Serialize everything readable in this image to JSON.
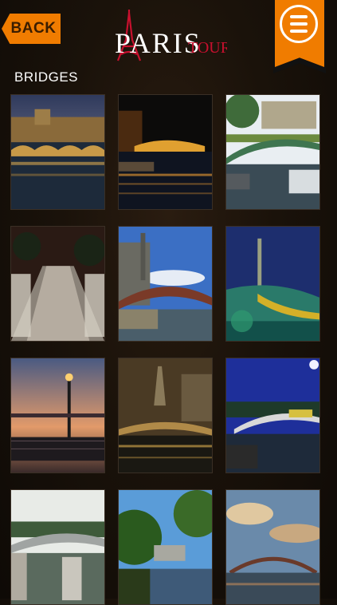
{
  "header": {
    "back_label": "BACK",
    "logo_text_main": "PARIS",
    "logo_text_sub": "TOURS"
  },
  "section": {
    "title": "BRIDGES"
  },
  "colors": {
    "accent": "#f07c00",
    "logo_red": "#c8102e"
  },
  "icons": {
    "menu": "hamburger-menu-icon",
    "back": "back-arrow-icon"
  }
}
